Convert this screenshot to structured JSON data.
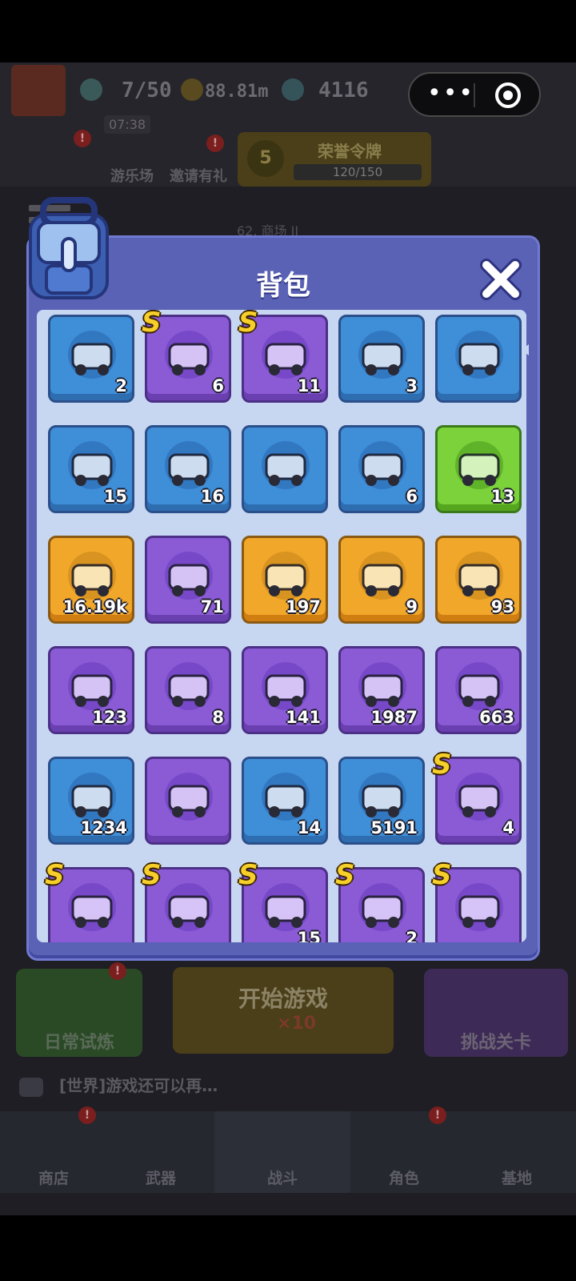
{
  "header": {
    "energy": "7/50",
    "gold": "88.81m",
    "gems": "4116",
    "timer": "07:38"
  },
  "nav_top": {
    "playground": "游乐场",
    "invite": "邀请有礼",
    "honor_title": "荣誉令牌",
    "honor_level": "5",
    "honor_progress": "120/150",
    "stage": "62. 商场 II"
  },
  "panel": {
    "title": "背包"
  },
  "items": [
    {
      "count": "2",
      "rarity": "blue",
      "icon": "vehicle-grenade-icon",
      "s": false
    },
    {
      "count": "6",
      "rarity": "purple",
      "icon": "drill-car-icon",
      "s": true
    },
    {
      "count": "11",
      "rarity": "purple",
      "icon": "spike-car-icon",
      "s": true
    },
    {
      "count": "3",
      "rarity": "blue",
      "icon": "red-jeep-icon",
      "s": false
    },
    {
      "count": "",
      "rarity": "blue",
      "icon": "armored-car-icon",
      "s": false
    },
    {
      "count": "15",
      "rarity": "blue",
      "icon": "purple-racer-icon",
      "s": false
    },
    {
      "count": "16",
      "rarity": "blue",
      "icon": "plow-truck-icon",
      "s": false
    },
    {
      "count": "",
      "rarity": "blue",
      "icon": "gray-racer-icon",
      "s": false
    },
    {
      "count": "6",
      "rarity": "blue",
      "icon": "green-jeep-icon",
      "s": false
    },
    {
      "count": "13",
      "rarity": "green",
      "icon": "blue-pickup-icon",
      "s": false
    },
    {
      "count": "16.19k",
      "rarity": "gold",
      "icon": "blue-crystal-card-icon",
      "s": false
    },
    {
      "count": "71",
      "rarity": "purple",
      "icon": "green-ticket-icon",
      "s": false
    },
    {
      "count": "197",
      "rarity": "gold",
      "icon": "gold-ticket-icon",
      "s": false
    },
    {
      "count": "9",
      "rarity": "gold",
      "icon": "character-ticket-icon",
      "s": false
    },
    {
      "count": "93",
      "rarity": "gold",
      "icon": "screen-chip-icon",
      "s": false
    },
    {
      "count": "123",
      "rarity": "purple",
      "icon": "blue-card-icon",
      "s": false
    },
    {
      "count": "8",
      "rarity": "purple",
      "icon": "dice-icon",
      "s": false
    },
    {
      "count": "141",
      "rarity": "purple",
      "icon": "purple-ticket-icon",
      "s": false
    },
    {
      "count": "1987",
      "rarity": "purple",
      "icon": "purple-crystal-icon",
      "s": false
    },
    {
      "count": "663",
      "rarity": "purple",
      "icon": "game-console-icon",
      "s": false
    },
    {
      "count": "1234",
      "rarity": "blue",
      "icon": "blue-crystal-icon",
      "s": false
    },
    {
      "count": "",
      "rarity": "purple",
      "icon": "blue-ticket-icon",
      "s": false
    },
    {
      "count": "14",
      "rarity": "blue",
      "icon": "hex-emblem-icon",
      "s": false
    },
    {
      "count": "5191",
      "rarity": "blue",
      "icon": "chip-icon",
      "s": false
    },
    {
      "count": "4",
      "rarity": "purple",
      "icon": "pilot-pet-icon",
      "s": true
    },
    {
      "count": "",
      "rarity": "purple",
      "icon": "white-cat-icon",
      "s": true
    },
    {
      "count": "",
      "rarity": "purple",
      "icon": "robot-gunner-icon",
      "s": true
    },
    {
      "count": "15",
      "rarity": "purple",
      "icon": "red-robot-icon",
      "s": true
    },
    {
      "count": "2",
      "rarity": "purple",
      "icon": "green-monster-icon",
      "s": true
    },
    {
      "count": "",
      "rarity": "purple",
      "icon": "black-cat-icon",
      "s": true
    }
  ],
  "s_label": "S",
  "bottom": {
    "daily_trial": "日常试炼",
    "start_game": "开始游戏",
    "start_cost": "×10",
    "challenge": "挑战关卡",
    "chat": "[世界]游戏还可以再…"
  },
  "nav_bottom": [
    "商店",
    "武器",
    "战斗",
    "角色",
    "基地"
  ],
  "colors": {
    "panel": "#5a62b6",
    "blue_rarity": "#3f8ed8",
    "purple_rarity": "#8b5bd6",
    "gold_rarity": "#f1a72a",
    "green_rarity": "#7cd23a",
    "s_badge": "#f7cf2a"
  }
}
